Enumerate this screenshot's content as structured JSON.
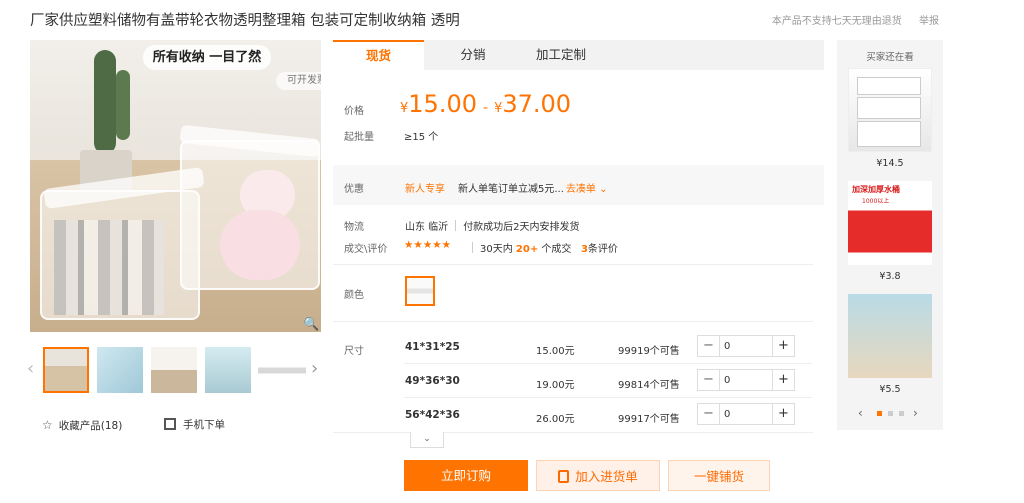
{
  "title": "厂家供应塑料储物有盖带轮衣物透明整理箱 包装可定制收纳箱 透明",
  "top_right": {
    "notice": "本产品不支持七天无理由退货",
    "report": "举报"
  },
  "gallery": {
    "banner": "所有收纳 一目了然",
    "invoice": "可开发票",
    "zoom_icon": "🔍",
    "prev_icon": "‹",
    "next_icon": "›",
    "thumbnail_count": 5
  },
  "actions": {
    "collect_icon": "☆",
    "collect": "收藏产品(18)",
    "mobile": "手机下单"
  },
  "tabs": [
    "现货",
    "分销",
    "加工定制"
  ],
  "price": {
    "label": "价格",
    "currency": "¥",
    "low": "15.00",
    "dash": "-",
    "high": "37.00",
    "minqty_label": "起批量",
    "minqty": "≥15 个"
  },
  "promo": {
    "label": "优惠",
    "tag": "新人专享",
    "text": "新人单笔订单立减5元...",
    "link": "去凑单 ⌄"
  },
  "logistics": {
    "label": "物流",
    "from": "山东 临沂",
    "ship": "付款成功后2天内安排发货"
  },
  "deals": {
    "label": "成交\\评价",
    "stars": "★★★★★",
    "prefix": "30天内",
    "count": "20+",
    "suffix": "个成交",
    "reviews": "3",
    "reviews_suffix": "条评价"
  },
  "color": {
    "label": "颜色"
  },
  "size": {
    "label": "尺寸",
    "rows": [
      {
        "name": "41*31*25",
        "price": "15.00元",
        "stock": "99919个可售",
        "qty": "0"
      },
      {
        "name": "49*36*30",
        "price": "19.00元",
        "stock": "99814个可售",
        "qty": "0"
      },
      {
        "name": "56*42*36",
        "price": "26.00元",
        "stock": "99917个可售",
        "qty": "0"
      }
    ],
    "minus": "−",
    "plus": "+",
    "expand": "⌄"
  },
  "buttons": {
    "buy": "立即订购",
    "cart": "加入进货单",
    "ship": "一键铺货"
  },
  "rail": {
    "title": "买家还在看",
    "items": [
      {
        "price": "¥14.5",
        "text": ""
      },
      {
        "price": "¥3.8",
        "text": "加深加厚水桶",
        "subtext": "1000以上"
      },
      {
        "price": "¥5.5",
        "text": ""
      }
    ],
    "prev": "‹",
    "next": "›"
  },
  "colors": {
    "accent": "#ff7300",
    "panel_bg": "#f2f2f2"
  }
}
